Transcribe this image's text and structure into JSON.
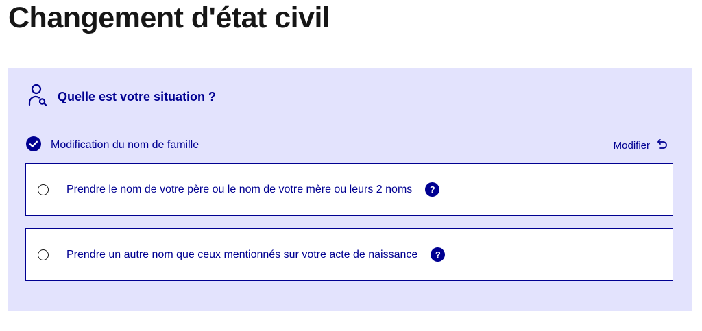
{
  "page": {
    "title": "Changement d'état civil"
  },
  "section": {
    "title": "Quelle est votre situation ?",
    "icon": "user-search-icon"
  },
  "selected": {
    "label": "Modification du nom de famille",
    "modify_label": "Modifier",
    "check_icon": "check-circle-icon",
    "modify_icon": "undo-arrow-icon"
  },
  "options": [
    {
      "label": "Prendre le nom de votre père ou le nom de votre mère ou leurs 2 noms",
      "help": "?"
    },
    {
      "label": "Prendre un autre nom que ceux mentionnés sur votre acte de naissance",
      "help": "?"
    }
  ],
  "colors": {
    "primary": "#000091",
    "panel_bg": "#e3e3fd",
    "title_text": "#161616"
  }
}
